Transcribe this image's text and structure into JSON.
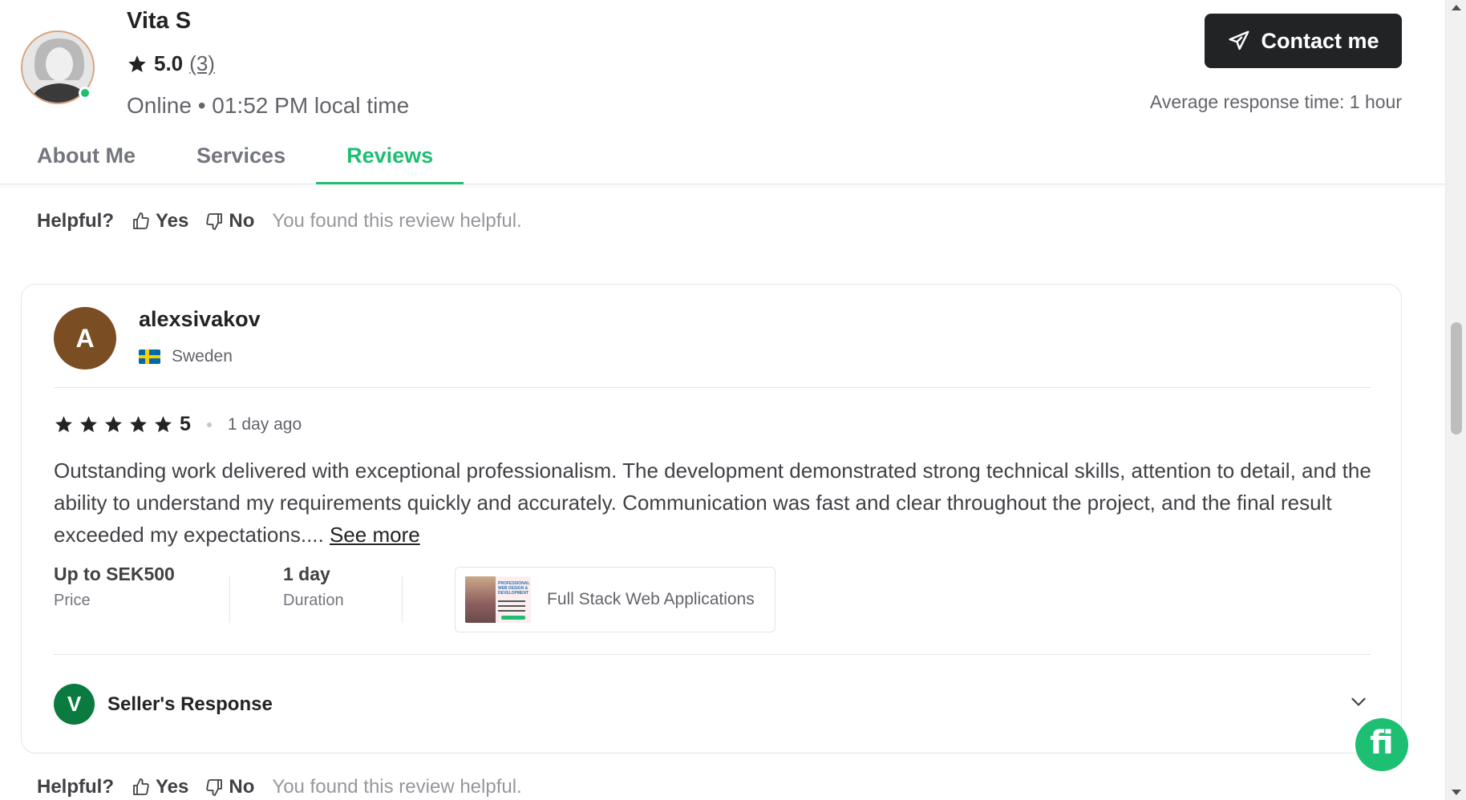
{
  "seller": {
    "name": "Vita S",
    "rating": "5.0",
    "rating_count": "(3)",
    "status": "Online • 01:52 PM local time",
    "contact_label": "Contact me",
    "response_time": "Average response time: 1 hour"
  },
  "tabs": [
    {
      "label": "About Me",
      "active": false
    },
    {
      "label": "Services",
      "active": false
    },
    {
      "label": "Reviews",
      "active": true
    }
  ],
  "helpful_top": {
    "label": "Helpful?",
    "yes": "Yes",
    "no": "No",
    "note": "You found this review helpful."
  },
  "review": {
    "avatar_letter": "A",
    "avatar_color": "#7a4e22",
    "reviewer": "alexsivakov",
    "country": "Sweden",
    "stars": 5,
    "score": "5",
    "time_ago": "1 day ago",
    "text": "Outstanding work delivered with exceptional professionalism. The development demonstrated strong technical skills, attention to detail, and the ability to understand my requirements quickly and accurately. Communication was fast and clear throughout the project, and the final result exceeded my expectations.... ",
    "see_more": "See more",
    "price_value": "Up to SEK500",
    "price_label": "Price",
    "duration_value": "1 day",
    "duration_label": "Duration",
    "gig_title": "Full Stack Web Applications",
    "gig_thumb_text": "PROFESSIONAL WEB DESIGN & DEVELOPMENT",
    "seller_response_letter": "V",
    "seller_response_label": "Seller's Response"
  },
  "helpful_bottom": {
    "label": "Helpful?",
    "yes": "Yes",
    "no": "No",
    "note": "You found this review helpful."
  },
  "fab_icon": "fiverr-logo-icon",
  "colors": {
    "accent": "#1dbf73",
    "dark": "#222325",
    "muted": "#62646a"
  }
}
